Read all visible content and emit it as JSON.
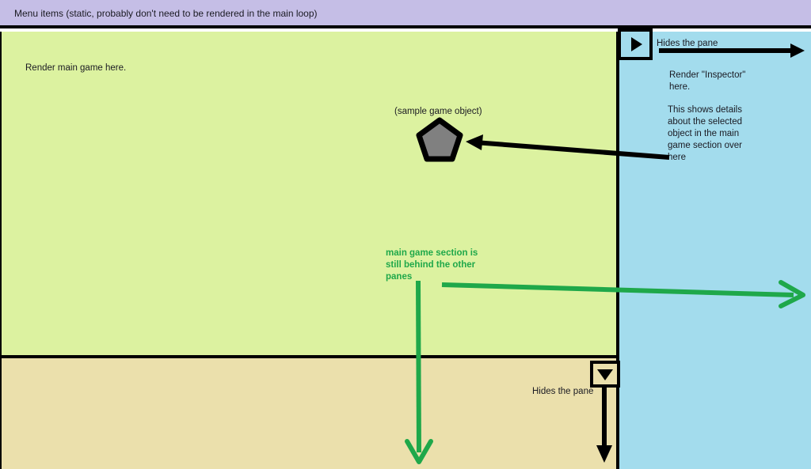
{
  "menubar": {
    "label": "Menu items (static, probably don't need to be rendered in the main loop)",
    "color": "#c5bee6"
  },
  "game_pane": {
    "hint": "Render main game here.",
    "sample_object_label": "(sample game object)",
    "note": "main game section is\nstill behind the other\npanes",
    "note_color": "#1fa84a",
    "background": "#dcf2a0",
    "object_fill": "#808080"
  },
  "inspector_pane": {
    "hide_label": "Hides the pane",
    "render_label": "Render \"Inspector\"\nhere.",
    "detail_label": "This shows details\nabout the selected\nobject in the main\ngame section over\nhere",
    "toggle_icon": "play-triangle-right-icon",
    "background": "#a3dced"
  },
  "bottom_pane": {
    "hide_label": "Hides the pane",
    "toggle_icon": "triangle-down-icon",
    "background": "#ebe0ac"
  },
  "arrows": {
    "inspector_hide_arrow": "arrow-right-black",
    "object_pointer_arrow": "arrow-left-black",
    "game_behind_arrow_right": "arrow-right-green",
    "game_behind_arrow_down": "arrow-down-green",
    "bottom_hide_arrow": "arrow-down-black",
    "black": "#000000",
    "green": "#1fa84a"
  }
}
